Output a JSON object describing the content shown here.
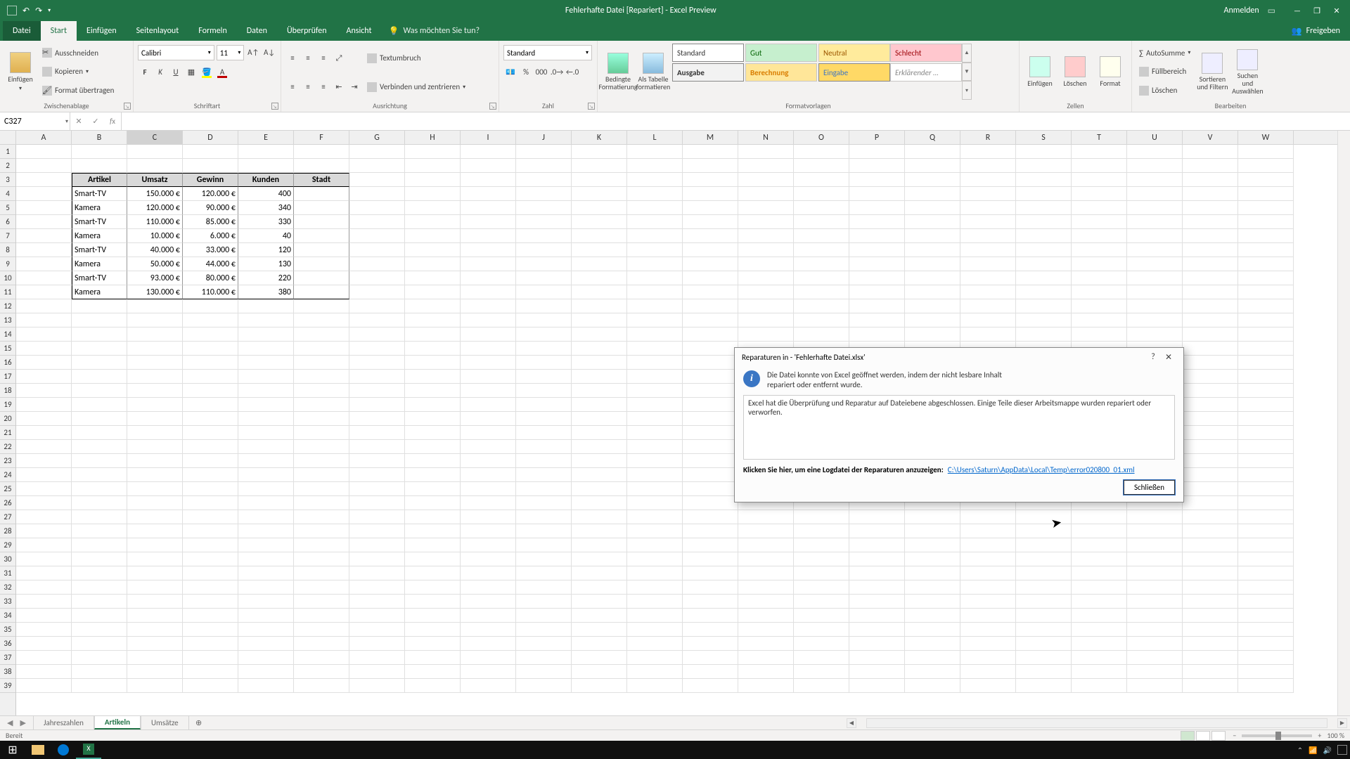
{
  "titlebar": {
    "title": "Fehlerhafte Datei [Repariert] - Excel Preview",
    "anmelden": "Anmelden"
  },
  "tabs": {
    "datei": "Datei",
    "start": "Start",
    "einfuegen": "Einfügen",
    "seitenlayout": "Seitenlayout",
    "formeln": "Formeln",
    "daten": "Daten",
    "ueberpruefen": "Überprüfen",
    "ansicht": "Ansicht",
    "tellme": "Was möchten Sie tun?",
    "freigeben": "Freigeben"
  },
  "ribbon": {
    "clipboard": {
      "einfuegen": "Einfügen",
      "ausschneiden": "Ausschneiden",
      "kopieren": "Kopieren",
      "format": "Format übertragen",
      "group": "Zwischenablage"
    },
    "font": {
      "name": "Calibri",
      "size": "11",
      "group": "Schriftart"
    },
    "align": {
      "umbruch": "Textumbruch",
      "verbinden": "Verbinden und zentrieren",
      "group": "Ausrichtung"
    },
    "number": {
      "format": "Standard",
      "group": "Zahl"
    },
    "styles": {
      "bedingte": "Bedingte Formatierung",
      "tabelle": "Als Tabelle formatieren",
      "g1": "Standard",
      "g2": "Gut",
      "g3": "Neutral",
      "g4": "Schlecht",
      "g5": "Ausgabe",
      "g6": "Berechnung",
      "g7": "Eingabe",
      "g8": "Erklärender …",
      "group": "Formatvorlagen"
    },
    "cells": {
      "einfuegen": "Einfügen",
      "loeschen": "Löschen",
      "format": "Format",
      "group": "Zellen"
    },
    "editing": {
      "autosumme": "AutoSumme",
      "fuell": "Füllbereich",
      "loeschen": "Löschen",
      "sortieren": "Sortieren und Filtern",
      "suchen": "Suchen und Auswählen",
      "group": "Bearbeiten"
    }
  },
  "namebox": "C327",
  "columns": [
    "A",
    "B",
    "C",
    "D",
    "E",
    "F",
    "G",
    "H",
    "I",
    "J",
    "K",
    "L",
    "M",
    "N",
    "O",
    "P",
    "Q",
    "R",
    "S",
    "T",
    "U",
    "V",
    "W"
  ],
  "table": {
    "headers": [
      "Artikel",
      "Umsatz",
      "Gewinn",
      "Kunden",
      "Stadt"
    ],
    "rows": [
      [
        "Smart-TV",
        "150.000 €",
        "120.000 €",
        "400",
        ""
      ],
      [
        "Kamera",
        "120.000 €",
        "90.000 €",
        "340",
        ""
      ],
      [
        "Smart-TV",
        "110.000 €",
        "85.000 €",
        "330",
        ""
      ],
      [
        "Kamera",
        "10.000 €",
        "6.000 €",
        "40",
        ""
      ],
      [
        "Smart-TV",
        "40.000 €",
        "33.000 €",
        "120",
        ""
      ],
      [
        "Kamera",
        "50.000 €",
        "44.000 €",
        "130",
        ""
      ],
      [
        "Smart-TV",
        "93.000 €",
        "80.000 €",
        "220",
        ""
      ],
      [
        "Kamera",
        "130.000 €",
        "110.000 €",
        "380",
        ""
      ]
    ]
  },
  "sheets": {
    "s1": "Jahreszahlen",
    "s2": "Artikeln",
    "s3": "Umsätze"
  },
  "status": {
    "ready": "Bereit",
    "zoom": "100 %"
  },
  "dialog": {
    "title": "Reparaturen in - 'Fehlerhafte Datei.xlsx'",
    "msg": "Die Datei konnte von Excel geöffnet werden, indem der nicht lesbare Inhalt repariert oder entfernt wurde.",
    "detail": "Excel hat die Überprüfung und Reparatur auf Dateiebene abgeschlossen. Einige Teile dieser Arbeitsmappe wurden repariert oder verworfen.",
    "loglabel": "Klicken Sie hier, um eine Logdatei der Reparaturen anzuzeigen:",
    "loglink": "C:\\Users\\Saturn\\AppData\\Local\\Temp\\error020800_01.xml",
    "close_btn": "Schließen"
  }
}
